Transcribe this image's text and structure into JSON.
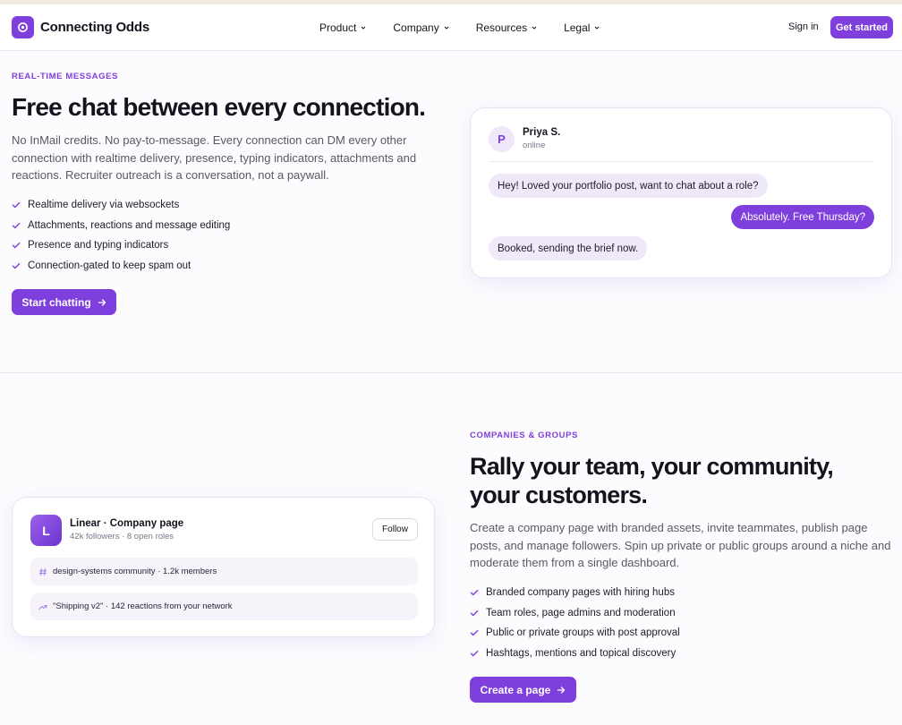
{
  "nav": {
    "brand": "Connecting Odds",
    "menu": [
      {
        "label": "Product"
      },
      {
        "label": "Company"
      },
      {
        "label": "Resources"
      },
      {
        "label": "Legal"
      }
    ],
    "sign_in": "Sign in",
    "get_started": "Get started"
  },
  "messages_section": {
    "eyebrow": "REAL-TIME MESSAGES",
    "title": "Free chat between every connection.",
    "description": "No InMail credits. No pay-to-message. Every connection can DM every other connection with realtime delivery, presence, typing indicators, attachments and reactions. Recruiter outreach is a conversation, not a paywall.",
    "features": [
      "Realtime delivery via websockets",
      "Attachments, reactions and message editing",
      "Presence and typing indicators",
      "Connection-gated to keep spam out"
    ],
    "cta": "Start chatting",
    "chat": {
      "avatar_initial": "P",
      "contact_name": "Priya S.",
      "contact_status": "online",
      "messages": [
        {
          "direction": "in",
          "text": "Hey! Loved your portfolio post, want to chat about a role?"
        },
        {
          "direction": "out",
          "text": "Absolutely. Free Thursday?"
        },
        {
          "direction": "in",
          "text": "Booked, sending the brief now."
        }
      ]
    }
  },
  "companies_section": {
    "eyebrow": "COMPANIES & GROUPS",
    "title_line1": "Rally your team, your community,",
    "title_line2": "your customers.",
    "description": "Create a company page with branded assets, invite teammates, publish page posts, and manage followers. Spin up private or public groups around a niche and moderate them from a single dashboard.",
    "features": [
      "Branded company pages with hiring hubs",
      "Team roles, page admins and moderation",
      "Public or private groups with post approval",
      "Hashtags, mentions and topical discovery"
    ],
    "cta": "Create a page",
    "card": {
      "avatar_initial": "L",
      "name": "Linear · Company page",
      "meta": "42k followers · 8 open roles",
      "follow_label": "Follow",
      "rows": [
        {
          "icon": "hash-icon",
          "text": "design-systems community · 1.2k members"
        },
        {
          "icon": "trending-up-icon",
          "text": "\"Shipping v2\" · 142 reactions from your network"
        }
      ]
    }
  },
  "colors": {
    "accent": "#7f3fdc",
    "text": "#16131f",
    "muted": "#5b5868",
    "bubble_in": "#efe9f9"
  }
}
